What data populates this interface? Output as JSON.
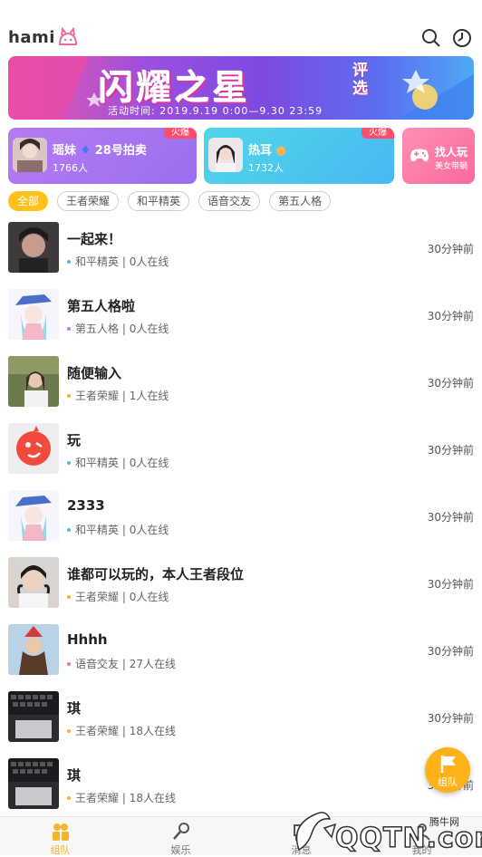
{
  "app": {
    "logo_text": "hami"
  },
  "banner": {
    "title": "闪耀之星",
    "subtitle": "评选",
    "time": "活动时间: 2019.9.19 0:00—9.30 23:59"
  },
  "feature_cards": [
    {
      "name": "瑶妹",
      "tag": "28号拍卖",
      "count": "1766人",
      "badge": "火爆"
    },
    {
      "name": "热耳",
      "count": "1732人",
      "badge": "火爆"
    },
    {
      "label": "找人玩",
      "sub": "美女带躺"
    }
  ],
  "filters": [
    "全部",
    "王者荣耀",
    "和平精英",
    "语音交友",
    "第五人格"
  ],
  "rooms": [
    {
      "title": "一起来！",
      "game": "和平精英",
      "online": "0人在线",
      "time": "30分钟前",
      "dot": "#5fb6e8"
    },
    {
      "title": "第五人格啦",
      "game": "第五人格",
      "online": "0人在线",
      "time": "30分钟前",
      "dot": "#b57bf3"
    },
    {
      "title": "随便输入",
      "game": "王者荣耀",
      "online": "1人在线",
      "time": "30分钟前",
      "dot": "#f5b52a"
    },
    {
      "title": "玩",
      "game": "和平精英",
      "online": "0人在线",
      "time": "30分钟前",
      "dot": "#5fb6e8"
    },
    {
      "title": "2333",
      "game": "和平精英",
      "online": "0人在线",
      "time": "30分钟前",
      "dot": "#5fb6e8"
    },
    {
      "title": "谁都可以玩的，本人王者段位",
      "game": "王者荣耀",
      "online": "0人在线",
      "time": "30分钟前",
      "dot": "#f5b52a"
    },
    {
      "title": "Hhhh",
      "game": "语音交友",
      "online": "27人在线",
      "time": "30分钟前",
      "dot": "#f36b9a"
    },
    {
      "title": "琪",
      "game": "王者荣耀",
      "online": "18人在线",
      "time": "30分钟前",
      "dot": "#f5b52a"
    },
    {
      "title": "琪",
      "game": "王者荣耀",
      "online": "18人在线",
      "time": "30分钟前",
      "dot": "#f5b52a"
    }
  ],
  "fab": {
    "label": "组队"
  },
  "tabs": [
    {
      "label": "组队",
      "icon": "team-icon"
    },
    {
      "label": "娱乐",
      "icon": "microphone-icon"
    },
    {
      "label": "消息",
      "icon": "message-icon"
    },
    {
      "label": "我的",
      "icon": "profile-icon"
    }
  ],
  "watermark": {
    "text": "QQTN.com",
    "top": "腾牛网"
  },
  "colors": {
    "accent": "#ffc21a",
    "tab_active": "#f5b52a"
  }
}
